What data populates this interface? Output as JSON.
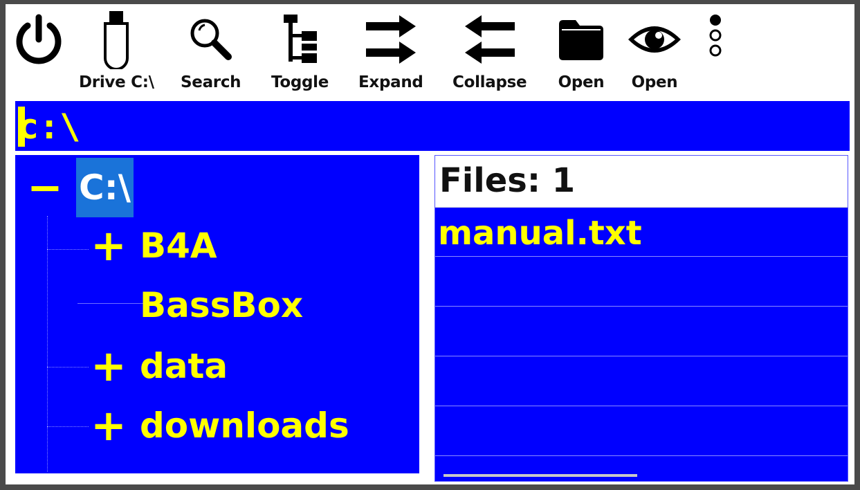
{
  "toolbar": {
    "power_icon": "power-icon",
    "drive_label": "Drive C:\\",
    "search_label": "Search",
    "toggle_label": "Toggle",
    "expand_label": "Expand",
    "collapse_label": "Collapse",
    "open_folder_label": "Open",
    "open_view_label": "Open",
    "more_icon": "more-vertical-icon"
  },
  "path_bar": {
    "value": "c:\\"
  },
  "tree": {
    "root": {
      "toggle": "−",
      "label": "C:\\"
    },
    "items": [
      {
        "toggle": "+",
        "label": "B4A"
      },
      {
        "toggle": "",
        "label": "BassBox"
      },
      {
        "toggle": "+",
        "label": "data"
      },
      {
        "toggle": "+",
        "label": "downloads"
      }
    ]
  },
  "file_list": {
    "header": "Files: 1",
    "files": [
      "manual.txt"
    ]
  },
  "colors": {
    "panel_bg": "#0000ff",
    "text": "#ffff00",
    "selected": "#1a73d9",
    "frame": "#4a4a4a"
  }
}
